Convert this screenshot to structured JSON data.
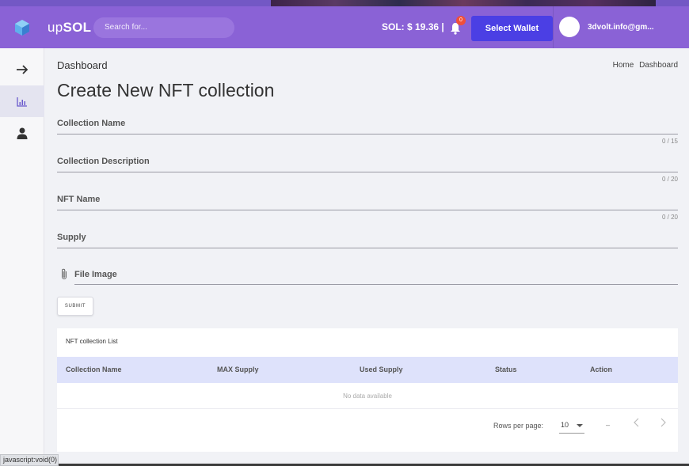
{
  "header": {
    "brand_prefix": "up",
    "brand_suffix": "SOL",
    "search_placeholder": "Search for...",
    "sol_balance": "SOL: $ 19.36 |",
    "notification_count": "0",
    "select_wallet_label": "Select Wallet",
    "user_email": "3dvolt.info@gm..."
  },
  "sidebar": {
    "items": [
      {
        "icon": "arrow-right-icon"
      },
      {
        "icon": "bar-chart-icon"
      },
      {
        "icon": "user-icon"
      }
    ]
  },
  "breadcrumb": {
    "title": "Dashboard",
    "items": [
      "Home",
      "Dashboard"
    ]
  },
  "page_title": "Create New NFT collection",
  "form": {
    "collection_name": {
      "label": "Collection Name",
      "counter": "0 / 15"
    },
    "collection_description": {
      "label": "Collection Description",
      "counter": "0 / 20"
    },
    "nft_name": {
      "label": "NFT Name",
      "counter": "0 / 20"
    },
    "supply": {
      "label": "Supply"
    },
    "file_image": {
      "label": "File Image",
      "icon": "paperclip-icon"
    },
    "submit_label": "SUBMIT"
  },
  "table": {
    "title": "NFT collection List",
    "columns": [
      "Collection Name",
      "MAX Supply",
      "Used Supply",
      "Status",
      "Action"
    ],
    "empty_text": "No data available",
    "rows_per_page_label": "Rows per page:",
    "rows_per_page_value": "10",
    "range_text": "–"
  },
  "statusbar": {
    "text": "javascript:void(0)"
  },
  "colors": {
    "header_bg": "#8a62d6",
    "wallet_button": "#4b3fe4",
    "table_header_bg": "#dee2fb",
    "badge": "#f04f3a"
  }
}
